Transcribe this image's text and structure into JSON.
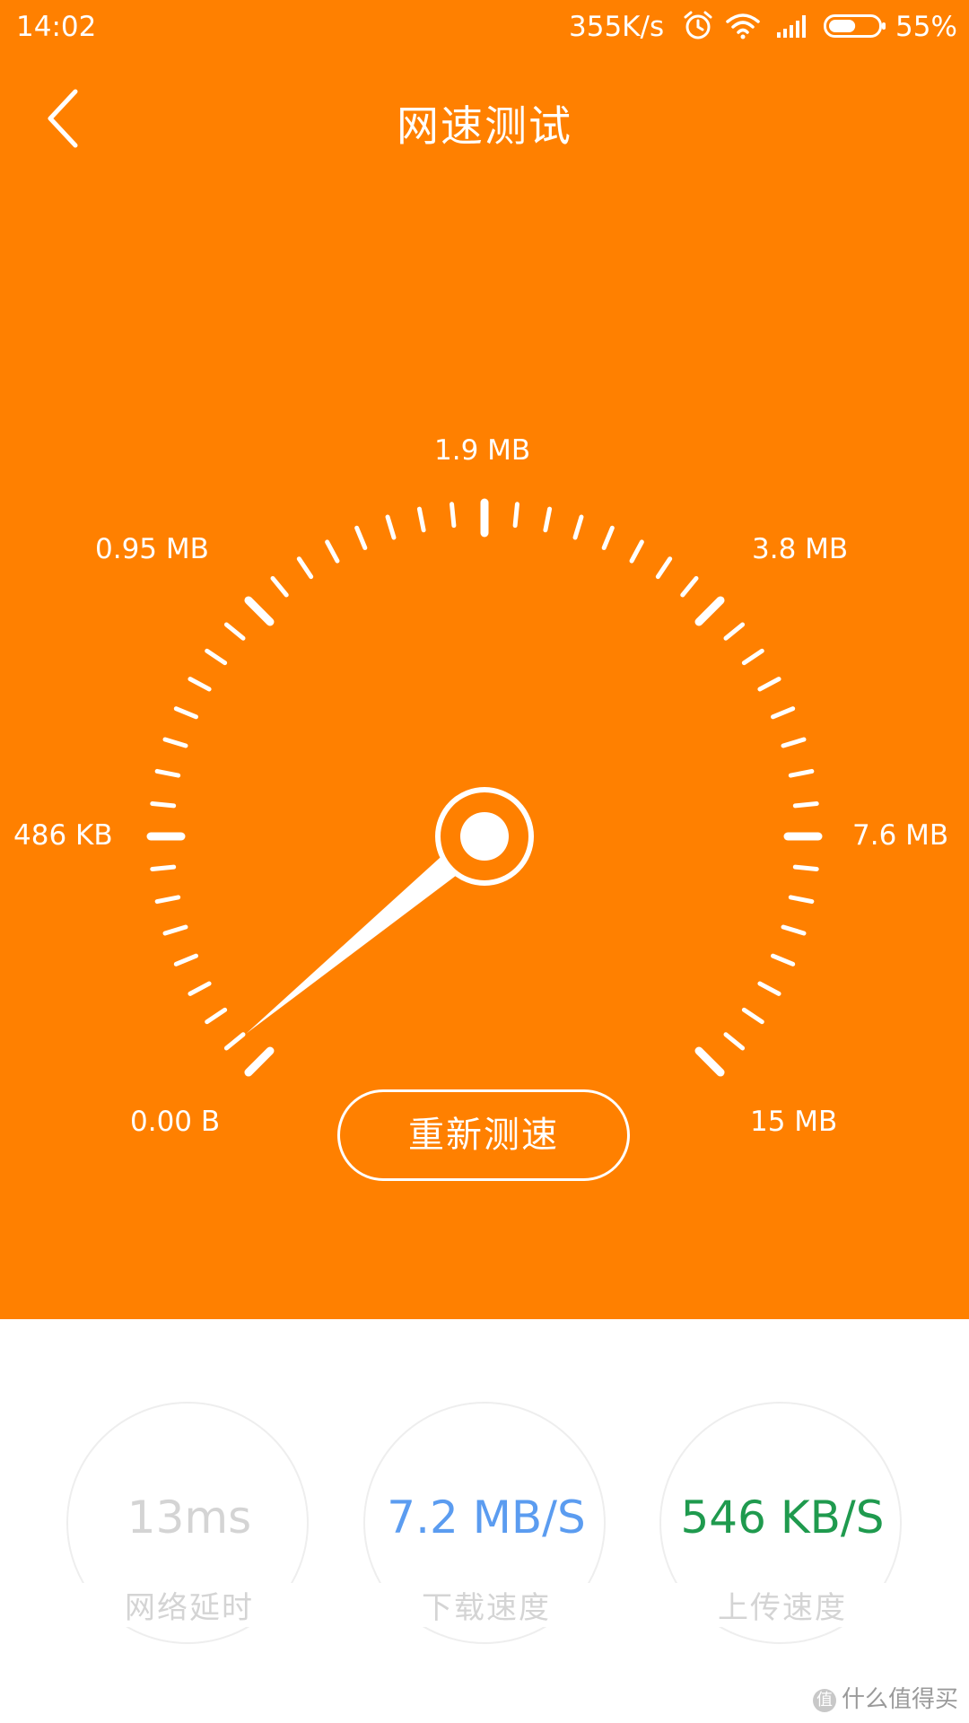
{
  "status_bar": {
    "time": "14:02",
    "net_speed": "355K/s",
    "battery_percent": "55%",
    "battery_level": 0.55,
    "icons": [
      "alarm-icon",
      "wifi-icon",
      "signal-icon",
      "battery-icon"
    ]
  },
  "header": {
    "back_icon": "back-arrow-icon",
    "title": "网速测试"
  },
  "gauge": {
    "scale_labels": [
      "0.00 B",
      "486 KB",
      "0.95 MB",
      "1.9 MB",
      "3.8 MB",
      "7.6 MB",
      "15 MB"
    ],
    "needle_fraction": 0.02,
    "colors": {
      "background": "#ff8000",
      "foreground": "#ffffff"
    }
  },
  "retest_button": {
    "label": "重新测速"
  },
  "stats": [
    {
      "value": "13ms",
      "label": "网络延时",
      "color": "#d4d4d4"
    },
    {
      "value": "7.2 MB/S",
      "label": "下载速度",
      "color": "#5b9cf0"
    },
    {
      "value": "546 KB/S",
      "label": "上传速度",
      "color": "#1f9a4e"
    }
  ],
  "watermark": {
    "badge": "值",
    "text": "什么值得买"
  }
}
